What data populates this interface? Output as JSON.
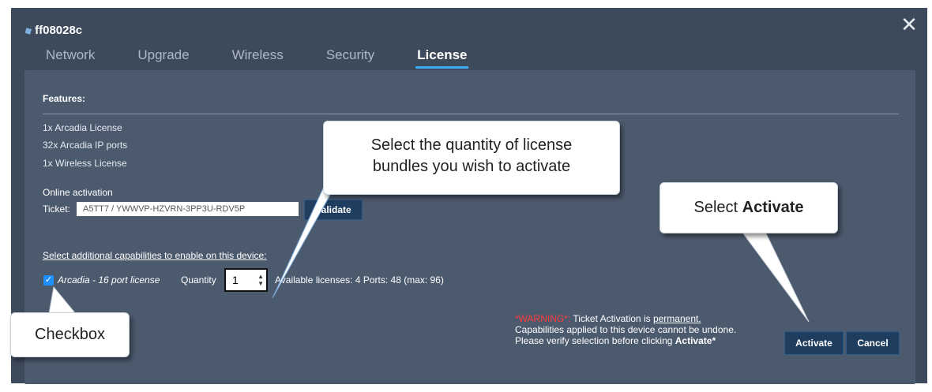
{
  "dialog": {
    "device_name": "ff08028c",
    "close_glyph": "✕",
    "tabs": [
      {
        "label": "Network",
        "active": false
      },
      {
        "label": "Upgrade",
        "active": false
      },
      {
        "label": "Wireless",
        "active": false
      },
      {
        "label": "Security",
        "active": false
      },
      {
        "label": "License",
        "active": true
      }
    ]
  },
  "features": {
    "title": "Features:",
    "items": [
      "1x Arcadia License",
      "32x Arcadia IP ports",
      "1x Wireless License"
    ]
  },
  "activation": {
    "title": "Online activation",
    "ticket_label": "Ticket:",
    "ticket_value": "A5TT7 / YWWVP-HZVRN-3PP3U-RDV5P",
    "validate_label": "Validate"
  },
  "capabilities": {
    "heading": "Select additional capabilities to enable on this device:",
    "license_name": "Arcadia - 16 port license",
    "checked": true,
    "quantity_label": "Quantity",
    "quantity_value": "1",
    "available_text": "Available licenses: 4   Ports: 48 (max: 96)"
  },
  "warning": {
    "prefix": "*WARNING*:",
    "line1_mid": " Ticket Activation is ",
    "line1_emph": "permanent.",
    "line2": "Capabilities applied to this device cannot be undone.",
    "line3_pre": "Please verify selection before clicking ",
    "line3_bold": "Activate*"
  },
  "buttons": {
    "activate": "Activate",
    "cancel": "Cancel"
  },
  "callouts": {
    "quantity_line1": "Select the quantity of license",
    "quantity_line2": "bundles you wish to activate",
    "activate_pre": "Select ",
    "activate_bold": "Activate",
    "checkbox": "Checkbox"
  },
  "colors": {
    "window_bg": "#3d4a5b",
    "panel_bg": "#4c5a6e",
    "accent": "#3fa9f5",
    "button_bg": "#1f3d5e",
    "warning_red": "#ff3b3b"
  },
  "icons": {
    "device": "tag-icon",
    "close": "close-icon",
    "checkbox": "checkmark-icon",
    "spinner": "spinner-arrows-icon"
  }
}
